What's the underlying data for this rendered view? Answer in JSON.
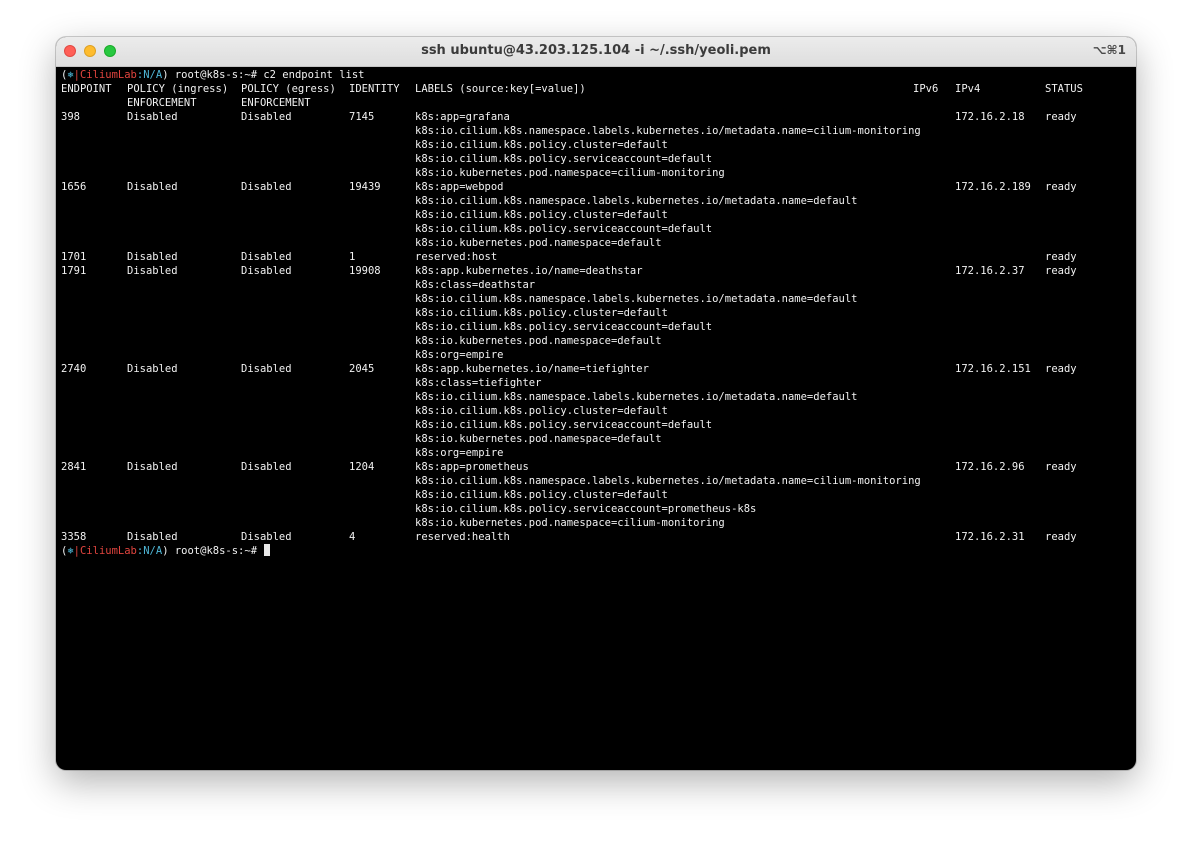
{
  "window": {
    "title": "ssh ubuntu@43.203.125.104 -i ~/.ssh/yeoli.pem",
    "shortcut": "⌥⌘1"
  },
  "prompt": {
    "open": "(",
    "star": "⎈",
    "bar": "|",
    "cluster": "CiliumLab",
    "ns": ":N/A",
    "close": ")",
    "user": " root@k8s-s:~# ",
    "command": "c2 endpoint list"
  },
  "headers": {
    "endpoint": "ENDPOINT",
    "policy_ingress": "POLICY (ingress)",
    "policy_egress": "POLICY (egress)",
    "enforcement_in": "ENFORCEMENT",
    "enforcement_eg": "ENFORCEMENT",
    "identity": "IDENTITY",
    "labels": "LABELS (source:key[=value])",
    "ipv6": "IPv6",
    "ipv4": "IPv4",
    "status": "STATUS"
  },
  "endpoints": [
    {
      "endpoint": "398",
      "ingress": "Disabled",
      "egress": "Disabled",
      "identity": "7145",
      "ipv6": "",
      "ipv4": "172.16.2.18",
      "status": "ready",
      "labels": [
        "k8s:app=grafana",
        "k8s:io.cilium.k8s.namespace.labels.kubernetes.io/metadata.name=cilium-monitoring",
        "k8s:io.cilium.k8s.policy.cluster=default",
        "k8s:io.cilium.k8s.policy.serviceaccount=default",
        "k8s:io.kubernetes.pod.namespace=cilium-monitoring"
      ]
    },
    {
      "endpoint": "1656",
      "ingress": "Disabled",
      "egress": "Disabled",
      "identity": "19439",
      "ipv6": "",
      "ipv4": "172.16.2.189",
      "status": "ready",
      "labels": [
        "k8s:app=webpod",
        "k8s:io.cilium.k8s.namespace.labels.kubernetes.io/metadata.name=default",
        "k8s:io.cilium.k8s.policy.cluster=default",
        "k8s:io.cilium.k8s.policy.serviceaccount=default",
        "k8s:io.kubernetes.pod.namespace=default"
      ]
    },
    {
      "endpoint": "1701",
      "ingress": "Disabled",
      "egress": "Disabled",
      "identity": "1",
      "ipv6": "",
      "ipv4": "",
      "status": "ready",
      "labels": [
        "reserved:host"
      ]
    },
    {
      "endpoint": "1791",
      "ingress": "Disabled",
      "egress": "Disabled",
      "identity": "19908",
      "ipv6": "",
      "ipv4": "172.16.2.37",
      "status": "ready",
      "labels": [
        "k8s:app.kubernetes.io/name=deathstar",
        "k8s:class=deathstar",
        "k8s:io.cilium.k8s.namespace.labels.kubernetes.io/metadata.name=default",
        "k8s:io.cilium.k8s.policy.cluster=default",
        "k8s:io.cilium.k8s.policy.serviceaccount=default",
        "k8s:io.kubernetes.pod.namespace=default",
        "k8s:org=empire"
      ]
    },
    {
      "endpoint": "2740",
      "ingress": "Disabled",
      "egress": "Disabled",
      "identity": "2045",
      "ipv6": "",
      "ipv4": "172.16.2.151",
      "status": "ready",
      "labels": [
        "k8s:app.kubernetes.io/name=tiefighter",
        "k8s:class=tiefighter",
        "k8s:io.cilium.k8s.namespace.labels.kubernetes.io/metadata.name=default",
        "k8s:io.cilium.k8s.policy.cluster=default",
        "k8s:io.cilium.k8s.policy.serviceaccount=default",
        "k8s:io.kubernetes.pod.namespace=default",
        "k8s:org=empire"
      ]
    },
    {
      "endpoint": "2841",
      "ingress": "Disabled",
      "egress": "Disabled",
      "identity": "1204",
      "ipv6": "",
      "ipv4": "172.16.2.96",
      "status": "ready",
      "labels": [
        "k8s:app=prometheus",
        "k8s:io.cilium.k8s.namespace.labels.kubernetes.io/metadata.name=cilium-monitoring",
        "k8s:io.cilium.k8s.policy.cluster=default",
        "k8s:io.cilium.k8s.policy.serviceaccount=prometheus-k8s",
        "k8s:io.kubernetes.pod.namespace=cilium-monitoring"
      ]
    },
    {
      "endpoint": "3358",
      "ingress": "Disabled",
      "egress": "Disabled",
      "identity": "4",
      "ipv6": "",
      "ipv4": "172.16.2.31",
      "status": "ready",
      "labels": [
        "reserved:health"
      ]
    }
  ]
}
